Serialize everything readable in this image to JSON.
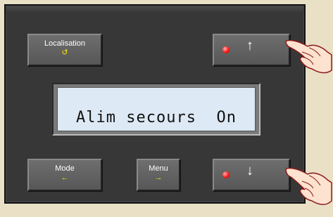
{
  "buttons": {
    "localisation": {
      "label": "Localisation",
      "symbol": "↺"
    },
    "mode": {
      "label": "Mode",
      "symbol": "←"
    },
    "menu": {
      "label": "Menu",
      "symbol": "→"
    },
    "up": {
      "symbol": "↑"
    },
    "down": {
      "symbol": "↓"
    }
  },
  "display": {
    "text": "Alim secours  On"
  },
  "icons": {
    "led": "red-led-indicator",
    "pointer": "pointing-hand-icon"
  },
  "colors": {
    "background": "#e9e0c6",
    "panel": "#373737",
    "lcd": "#dde9f4",
    "symbol_yellow": "#ffe400",
    "led_red": "#ff1a1a"
  }
}
